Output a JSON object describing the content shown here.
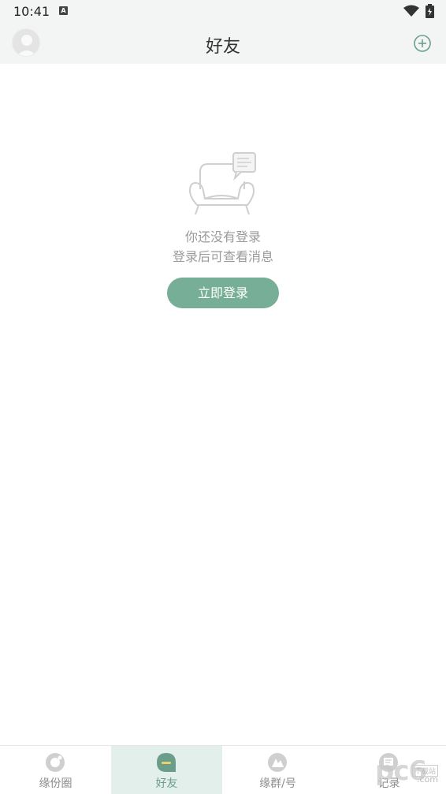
{
  "status_bar": {
    "time": "10:41",
    "notification_icon_letter": "A"
  },
  "header": {
    "title": "好友",
    "avatar_icon": "avatar-icon",
    "add_icon": "plus-circle-icon",
    "accent_color": "#6a9e8a"
  },
  "empty_state": {
    "illustration_icon": "sofa-chat-icon",
    "line1": "你还没有登录",
    "line2": "登录后可查看消息",
    "login_button": "立即登录",
    "button_color": "#76ae98"
  },
  "bottom_nav": {
    "tabs": [
      {
        "label": "缘份圈",
        "icon": "circle-icon",
        "active": false
      },
      {
        "label": "好友",
        "icon": "chat-bubble-icon",
        "active": true
      },
      {
        "label": "缘群/号",
        "icon": "group-icon",
        "active": false
      },
      {
        "label": "记录",
        "icon": "record-icon",
        "active": false
      }
    ]
  },
  "watermark": {
    "main": "pc6",
    "sub": "下载站",
    "domain": ".com"
  }
}
